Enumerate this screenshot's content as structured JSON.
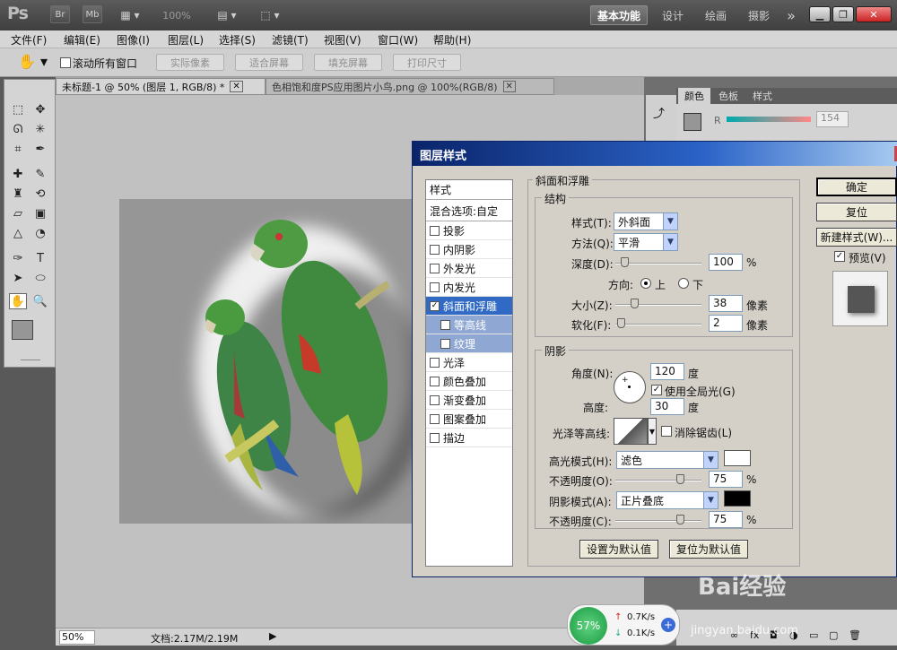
{
  "app": {
    "logo": "Ps",
    "bridge_label": "Br",
    "minibridge_label": "Mb",
    "zoom_display": "100%",
    "workspaces": [
      "基本功能",
      "设计",
      "绘画",
      "摄影"
    ],
    "more_label": "»"
  },
  "menu": [
    "文件(F)",
    "编辑(E)",
    "图像(I)",
    "图层(L)",
    "选择(S)",
    "滤镜(T)",
    "视图(V)",
    "窗口(W)",
    "帮助(H)"
  ],
  "options": {
    "scroll_all_label": "滚动所有窗口",
    "buttons": [
      "实际像素",
      "适合屏幕",
      "填充屏幕",
      "打印尺寸"
    ]
  },
  "tabs": [
    {
      "label": "未标题-1 @ 50% (图层 1, RGB/8) *"
    },
    {
      "label": "色相饱和度PS应用图片小鸟.png @ 100%(RGB/8)"
    }
  ],
  "status": {
    "zoom": "50%",
    "doc": "文档:2.17M/2.19M"
  },
  "panel": {
    "tabs": [
      "颜色",
      "色板",
      "样式"
    ],
    "r_label": "R",
    "r_value": "154"
  },
  "dialog": {
    "title": "图层样式",
    "styles_header": "样式",
    "blend_options": "混合选项:自定",
    "style_items": [
      {
        "label": "投影",
        "checked": false
      },
      {
        "label": "内阴影",
        "checked": false
      },
      {
        "label": "外发光",
        "checked": false
      },
      {
        "label": "内发光",
        "checked": false
      },
      {
        "label": "斜面和浮雕",
        "checked": true
      },
      {
        "label": "等高线",
        "checked": false
      },
      {
        "label": "纹理",
        "checked": false
      },
      {
        "label": "光泽",
        "checked": false
      },
      {
        "label": "颜色叠加",
        "checked": false
      },
      {
        "label": "渐变叠加",
        "checked": false
      },
      {
        "label": "图案叠加",
        "checked": false
      },
      {
        "label": "描边",
        "checked": false
      }
    ],
    "section_title": "斜面和浮雕",
    "structure": {
      "group": "结构",
      "style_label": "样式(T):",
      "style_value": "外斜面",
      "technique_label": "方法(Q):",
      "technique_value": "平滑",
      "depth_label": "深度(D):",
      "depth_value": "100",
      "depth_unit": "%",
      "direction_label": "方向:",
      "dir_up": "上",
      "dir_down": "下",
      "size_label": "大小(Z):",
      "size_value": "38",
      "size_unit": "像素",
      "soften_label": "软化(F):",
      "soften_value": "2",
      "soften_unit": "像素"
    },
    "shading": {
      "group": "阴影",
      "angle_label": "角度(N):",
      "angle_value": "120",
      "angle_unit": "度",
      "global_light": "使用全局光(G)",
      "altitude_label": "高度:",
      "altitude_value": "30",
      "altitude_unit": "度",
      "gloss_label": "光泽等高线:",
      "antialias": "消除锯齿(L)",
      "highlight_label": "高光模式(H):",
      "highlight_value": "滤色",
      "highlight_color": "#ffffff",
      "hl_opacity_label": "不透明度(O):",
      "hl_opacity_value": "75",
      "shadow_label": "阴影模式(A):",
      "shadow_value": "正片叠底",
      "shadow_color": "#000000",
      "sh_opacity_label": "不透明度(C):",
      "sh_opacity_value": "75",
      "pct": "%"
    },
    "make_default": "设置为默认值",
    "reset_default": "复位为默认值",
    "ok": "确定",
    "reset": "复位",
    "new_style": "新建样式(W)...",
    "preview": "预览(V)"
  },
  "meter": {
    "value": "57%",
    "up": "0.7K/s",
    "down": "0.1K/s"
  },
  "watermark": {
    "brand": "Bai经验",
    "url": "jingyan.baidu.com"
  }
}
